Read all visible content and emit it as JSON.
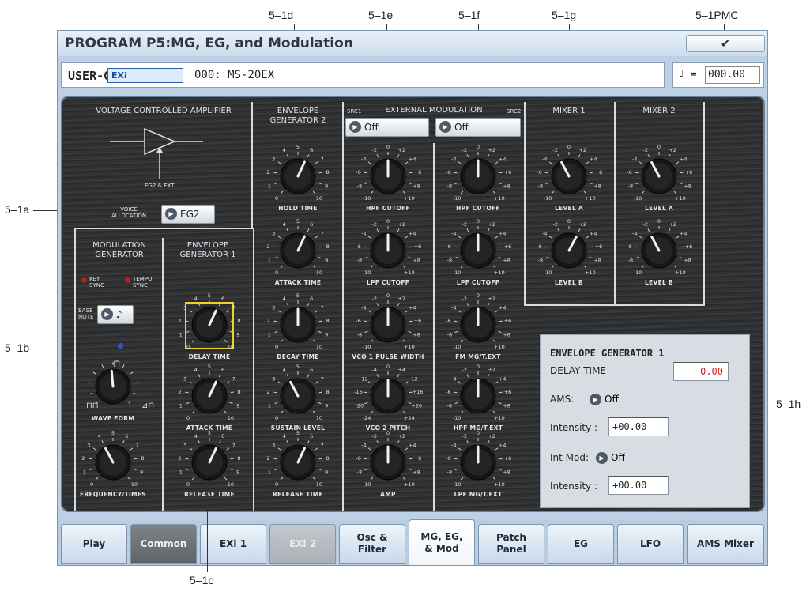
{
  "callouts": {
    "c5_1a": "5–1a",
    "c5_1b": "5–1b",
    "c5_1c": "5–1c",
    "c5_1d": "5–1d",
    "c5_1e": "5–1e",
    "c5_1f": "5–1f",
    "c5_1g": "5–1g",
    "c5_1h": "5–1h",
    "c5_1pmc": "5–1PMC"
  },
  "header": {
    "title": "PROGRAM P5:MG, EG, and Modulation",
    "menu_icon": "chevron-down-icon"
  },
  "program": {
    "bank": "USER-G",
    "engine": "EXi",
    "name": "000: MS-20EX"
  },
  "tempo": {
    "symbol": "♩ =",
    "value": "000.00"
  },
  "vca": {
    "title": "VOLTAGE CONTROLLED AMPLIFIER",
    "eg_label": "EG2 & EXT",
    "voice_alloc_label": "VOICE\nALLOCATION",
    "voice_alloc_value": "EG2"
  },
  "mg": {
    "title": "MODULATION\nGENERATOR",
    "key_sync": "KEY\nSYNC",
    "tempo_sync": "TEMPO\nSYNC",
    "base_note_label": "BASE\nNOTE",
    "base_note_value": "♪",
    "waveform_label": "WAVE FORM",
    "freq_label": "FREQUENCY/TIMES"
  },
  "eg1": {
    "title": "ENVELOPE\nGENERATOR 1",
    "delay": "DELAY TIME",
    "attack": "ATTACK TIME",
    "release": "RELEASE TIME"
  },
  "eg2": {
    "title": "ENVELOPE\nGENERATOR 2",
    "hold": "HOLD TIME",
    "attack": "ATTACK TIME",
    "decay": "DECAY TIME",
    "sustain": "SUSTAIN LEVEL",
    "release": "RELEASE TIME"
  },
  "extmod": {
    "title": "EXTERNAL MODULATION",
    "src1": "SRC1",
    "src2": "SRC2",
    "src1_value": "Off",
    "src2_value": "Off",
    "col1": [
      "HPF CUTOFF",
      "LPF CUTOFF",
      "VCO 1 PULSE WIDTH",
      "VCO 2 PITCH",
      "AMP"
    ],
    "col2": [
      "HPF CUTOFF",
      "LPF CUTOFF",
      "FM MG/T.EXT",
      "HPF MG/T.EXT",
      "LPF MG/T.EXT"
    ]
  },
  "mixer1": {
    "title": "MIXER 1",
    "a": "LEVEL A",
    "b": "LEVEL B"
  },
  "mixer2": {
    "title": "MIXER 2",
    "a": "LEVEL A",
    "b": "LEVEL B"
  },
  "detail": {
    "title": "ENVELOPE GENERATOR 1",
    "param": "DELAY TIME",
    "param_value": "0.00",
    "ams_label": "AMS:",
    "ams_value": "Off",
    "intensity_label": "Intensity :",
    "intensity_value": "+00.00",
    "intmod_label": "Int Mod:",
    "intmod_value": "Off",
    "intensity2_label": "Intensity :",
    "intensity2_value": "+00.00"
  },
  "tabs": [
    "Play",
    "Common",
    "EXi 1",
    "EXi 2",
    "Osc &\nFilter",
    "MG, EG,\n& Mod",
    "Patch\nPanel",
    "EG",
    "LFO",
    "AMS Mixer"
  ],
  "colors": {
    "panel_bg": "#2f3133",
    "selection": "#f0d02a",
    "param_value": "#d42020",
    "led": "#b02020"
  }
}
